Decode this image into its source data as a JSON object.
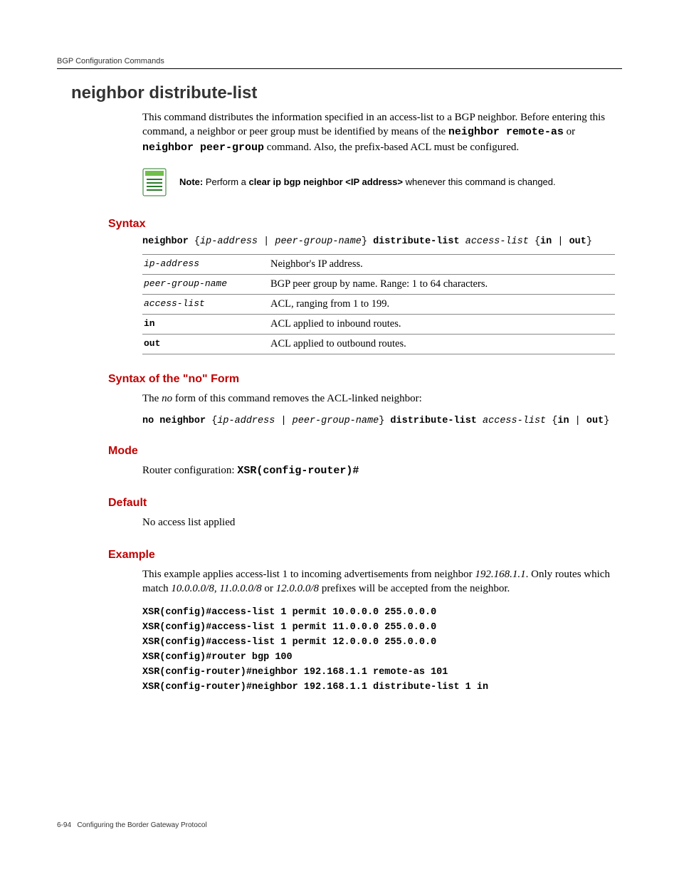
{
  "header": {
    "section": "BGP Configuration Commands"
  },
  "title": "neighbor distribute-list",
  "intro": {
    "p1a": "This command distributes the information specified in an access-list to a BGP neighbor. Before entering this command, a neighbor or peer group must be identified by means of the ",
    "cmd1": "neighbor remote-as",
    "mid": " or ",
    "cmd2": "neighbor peer-group",
    "p1b": " command. Also, the prefix-based ACL must be configured."
  },
  "note": {
    "label": "Note:",
    "t1": " Perform a ",
    "cmd": "clear ip bgp neighbor <IP address>",
    "t2": " whenever this command is changed."
  },
  "sections": {
    "syntax": "Syntax",
    "noform": "Syntax of the \"no\" Form",
    "mode": "Mode",
    "default": "Default",
    "example": "Example"
  },
  "syntax": {
    "tok": {
      "neighbor": "neighbor",
      "ob": " {",
      "ip": "ip-address",
      "pipe": " | ",
      "pg": "peer-group-name",
      "cb": "} ",
      "dl": "distribute-list",
      "sp": " ",
      "al": "access-list",
      "ob2": " {",
      "in": "in",
      "out": "out",
      "cb2": "}"
    },
    "params": [
      {
        "name": "ip-address",
        "ital": true,
        "desc": "Neighbor's IP address."
      },
      {
        "name": "peer-group-name",
        "ital": true,
        "desc": "BGP peer group by name. Range: 1 to 64 characters."
      },
      {
        "name": "access-list",
        "ital": true,
        "desc": "ACL, ranging from 1 to 199."
      },
      {
        "name": "in",
        "ital": false,
        "desc": "ACL applied to inbound routes."
      },
      {
        "name": "out",
        "ital": false,
        "desc": "ACL applied to outbound routes."
      }
    ]
  },
  "noform": {
    "text_a": "The ",
    "text_no": "no",
    "text_b": " form of this command removes the ACL-linked neighbor:",
    "prefix": "no neighbor"
  },
  "mode": {
    "text": "Router configuration: ",
    "prompt": "XSR(config-router)#"
  },
  "default_sec": {
    "text": "No access list applied"
  },
  "example": {
    "p_a": "This example applies access-list 1 to incoming advertisements from neighbor ",
    "ip": "192.168.1.1",
    "p_b": ". Only routes which match ",
    "pfx1": "10.0.0.0/8",
    "c1": ", ",
    "pfx2": "11.0.0.0/8",
    "c2": " or ",
    "pfx3": "12.0.0.0/8",
    "p_c": " prefixes will be accepted from the neighbor.",
    "code": "XSR(config)#access-list 1 permit 10.0.0.0 255.0.0.0\nXSR(config)#access-list 1 permit 11.0.0.0 255.0.0.0\nXSR(config)#access-list 1 permit 12.0.0.0 255.0.0.0\nXSR(config)#router bgp 100\nXSR(config-router)#neighbor 192.168.1.1 remote-as 101\nXSR(config-router)#neighbor 192.168.1.1 distribute-list 1 in"
  },
  "footer": {
    "page": "6-94",
    "title": "Configuring the Border Gateway Protocol"
  }
}
